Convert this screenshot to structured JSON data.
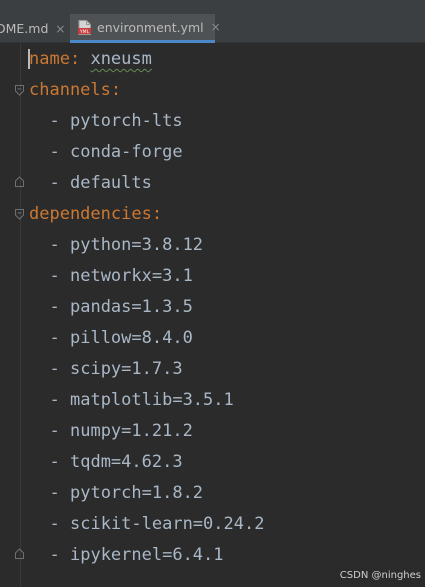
{
  "tabs": [
    {
      "label": "DME.md",
      "close": "×",
      "active": false
    },
    {
      "label": "environment.yml",
      "close": "×",
      "active": true,
      "icon_text": "YML"
    }
  ],
  "editor": {
    "name_line": {
      "key": "name",
      "colon": ":",
      "value": "xneusm"
    },
    "channels": {
      "key": "channels",
      "colon": ":",
      "items": [
        {
          "dash": "-",
          "value": "pytorch-lts"
        },
        {
          "dash": "-",
          "value": "conda-forge"
        },
        {
          "dash": "-",
          "value": "defaults"
        }
      ]
    },
    "dependencies": {
      "key": "dependencies",
      "colon": ":",
      "items": [
        {
          "dash": "-",
          "value": "python=3.8.12"
        },
        {
          "dash": "-",
          "value": "networkx=3.1"
        },
        {
          "dash": "-",
          "value": "pandas=1.3.5"
        },
        {
          "dash": "-",
          "value": "pillow=8.4.0"
        },
        {
          "dash": "-",
          "value": "scipy=1.7.3"
        },
        {
          "dash": "-",
          "value": "matplotlib=3.5.1"
        },
        {
          "dash": "-",
          "value": "numpy=1.21.2"
        },
        {
          "dash": "-",
          "value": "tqdm=4.62.3"
        },
        {
          "dash": "-",
          "value": "pytorch=1.8.2"
        },
        {
          "dash": "-",
          "value": "scikit-learn=0.24.2"
        },
        {
          "dash": "-",
          "value": "ipykernel=6.4.1"
        }
      ]
    }
  },
  "watermark": "CSDN @ninghes",
  "colors": {
    "background": "#2b2b2b",
    "key": "#cc7832",
    "text": "#a9b7c6",
    "tab_accent": "#4a88c7"
  }
}
